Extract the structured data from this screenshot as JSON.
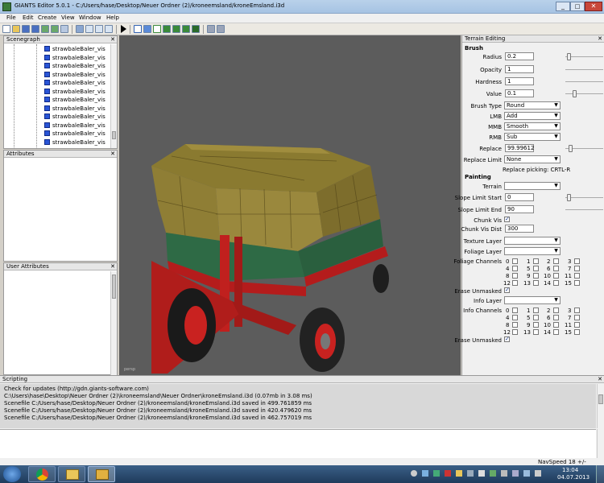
{
  "window": {
    "title": "GIANTS Editor 5.0.1 - C:/Users/hase/Desktop/Neuer Ordner (2)/kroneemsland/kroneEmsland.i3d"
  },
  "menu": [
    "File",
    "Edit",
    "Create",
    "View",
    "Window",
    "Help"
  ],
  "scenegraph": {
    "title": "Scenegraph",
    "items": [
      "strawbaleBaler_vis",
      "strawbaleBaler_vis",
      "strawbaleBaler_vis",
      "strawbaleBaler_vis",
      "strawbaleBaler_vis",
      "strawbaleBaler_vis",
      "strawbaleBaler_vis",
      "strawbaleBaler_vis",
      "strawbaleBaler_vis",
      "strawbaleBaler_vis",
      "strawbaleBaler_vis",
      "strawbaleBaler_vis"
    ]
  },
  "attributes": {
    "title": "Attributes"
  },
  "user_attributes": {
    "title": "User Attributes"
  },
  "viewport": {
    "camera_label": "persp"
  },
  "terrain": {
    "title": "Terrain Editing",
    "brush_header": "Brush",
    "radius_label": "Radius",
    "radius": "0.2",
    "opacity_label": "Opacity",
    "opacity": "1",
    "hardness_label": "Hardness",
    "hardness": "1",
    "value_label": "Value",
    "value": "0.1",
    "brush_type_label": "Brush Type",
    "brush_type": "Round",
    "lmb_label": "LMB",
    "lmb": "Add",
    "mmb_label": "MMB",
    "mmb": "Smooth",
    "rmb_label": "RMB",
    "rmb": "Sub",
    "replace_label": "Replace",
    "replace": "99.99612",
    "replace_limit_label": "Replace Limit",
    "replace_limit": "None",
    "replace_picking": "Replace picking: CRTL-R",
    "painting_header": "Painting",
    "terrain_label": "Terrain",
    "slope_start_label": "Slope Limit Start",
    "slope_start": "0",
    "slope_end_label": "Slope Limit End",
    "slope_end": "90",
    "chunk_vis_label": "Chunk Vis",
    "chunk_vis_dist_label": "Chunk Vis Dist",
    "chunk_vis_dist": "300",
    "texture_layer_label": "Texture Layer",
    "foliage_layer_label": "Foliage Layer",
    "foliage_channels_label": "Foliage Channels",
    "erase_unmasked_label": "Erase Unmasked",
    "info_layer_label": "Info Layer",
    "info_channels_label": "Info Channels",
    "erase_unmasked2_label": "Erase Unmasked",
    "channels": [
      "0",
      "1",
      "2",
      "3",
      "4",
      "5",
      "6",
      "7",
      "8",
      "9",
      "10",
      "11",
      "12",
      "13",
      "14",
      "15"
    ]
  },
  "scripting": {
    "title": "Scripting",
    "lines": [
      "Check for updates (http://gdn.giants-software.com)",
      "C:\\Users\\hase\\Desktop\\Neuer Ordner (2)\\kroneemsland\\Neuer Ordner\\kroneEmsland.i3d (0.07mb in 3.08 ms)",
      "Scenefile C:/Users/hase/Desktop/Neuer Ordner (2)/kroneemsland/kroneEmsland.i3d saved in 499.761859 ms",
      "Scenefile C:/Users/hase/Desktop/Neuer Ordner (2)/kroneemsland/kroneEmsland.i3d saved in 420.479620 ms",
      "Scenefile C:/Users/hase/Desktop/Neuer Ordner (2)/kroneemsland/kroneEmsland.i3d saved in 462.757019 ms"
    ]
  },
  "status": {
    "navspeed": "NavSpeed 18 +/-"
  },
  "taskbar": {
    "time": "13:04",
    "date": "04.07.2013"
  }
}
